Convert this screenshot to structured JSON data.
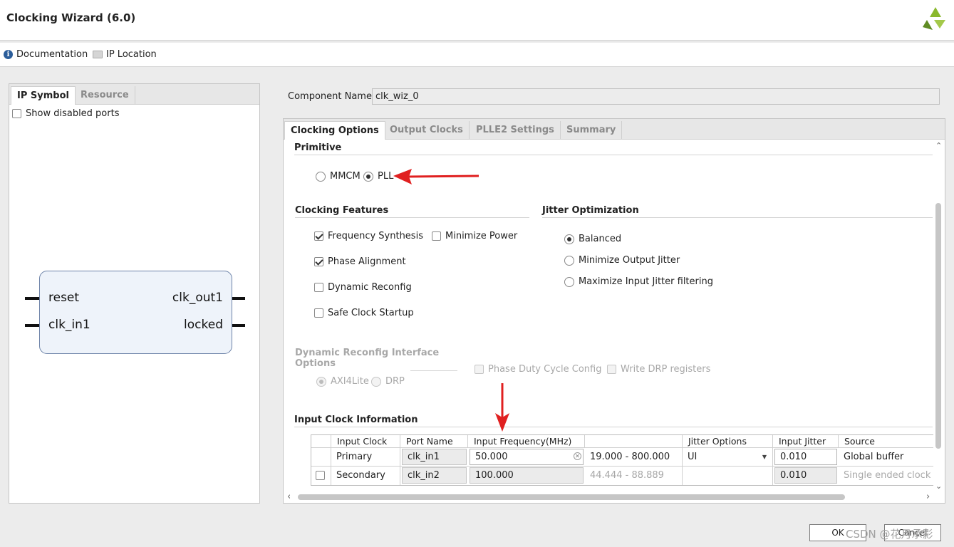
{
  "window": {
    "title": "Clocking Wizard (6.0)",
    "logo_icon": "vendor-logo"
  },
  "toolbar": {
    "documentation": "Documentation",
    "ip_location": "IP Location"
  },
  "left_panel": {
    "tabs": [
      "IP Symbol",
      "Resource"
    ],
    "active_tab": "IP Symbol",
    "show_disabled_ports": "Show disabled ports",
    "symbol": {
      "in_ports": [
        "reset",
        "clk_in1"
      ],
      "out_ports": [
        "clk_out1",
        "locked"
      ]
    }
  },
  "component": {
    "label": "Component Name",
    "value": "clk_wiz_0"
  },
  "tabs": [
    "Clocking Options",
    "Output Clocks",
    "PLLE2 Settings",
    "Summary"
  ],
  "active_tab": "Clocking Options",
  "primitive": {
    "title": "Primitive",
    "options": [
      {
        "label": "MMCM",
        "selected": false
      },
      {
        "label": "PLL",
        "selected": true
      }
    ]
  },
  "clocking_features": {
    "title": "Clocking Features",
    "frequency_synthesis": "Frequency Synthesis",
    "minimize_power": "Minimize Power",
    "phase_alignment": "Phase Alignment",
    "dynamic_reconfig": "Dynamic Reconfig",
    "safe_clock_startup": "Safe Clock Startup"
  },
  "jitter_optimization": {
    "title": "Jitter Optimization",
    "balanced": "Balanced",
    "minimize_output_jitter": "Minimize Output Jitter",
    "maximize_input_jitter": "Maximize Input Jitter filtering"
  },
  "dynamic_reconfig_interface": {
    "title_line1": "Dynamic Reconfig Interface",
    "title_line2": "Options",
    "axi4lite": "AXI4Lite",
    "drp": "DRP",
    "phase_duty_cycle": "Phase Duty Cycle Config",
    "write_drp": "Write DRP registers"
  },
  "input_clock": {
    "title": "Input Clock Information",
    "headers": [
      "Input Clock",
      "Port Name",
      "Input Frequency(MHz)",
      "",
      "Jitter Options",
      "Input Jitter",
      "Source"
    ],
    "rows": [
      {
        "name": "Primary",
        "port": "clk_in1",
        "freq": "50.000",
        "range": "19.000 - 800.000",
        "jitter_option": "UI",
        "jitter": "0.010",
        "source": "Global buffer"
      },
      {
        "name": "Secondary",
        "port": "clk_in2",
        "freq": "100.000",
        "range": "44.444 - 88.889",
        "jitter_option": "",
        "jitter": "0.010",
        "source": "Single ended clock c"
      }
    ]
  },
  "buttons": {
    "ok": "OK",
    "cancel": "Cancel"
  },
  "watermark": "CSDN @花月承影",
  "colors": {
    "accent": "#e02020",
    "selected_tab_bg": "#ffffff",
    "symbol_border": "#6d83a8",
    "logo_green": "#88b82e"
  }
}
